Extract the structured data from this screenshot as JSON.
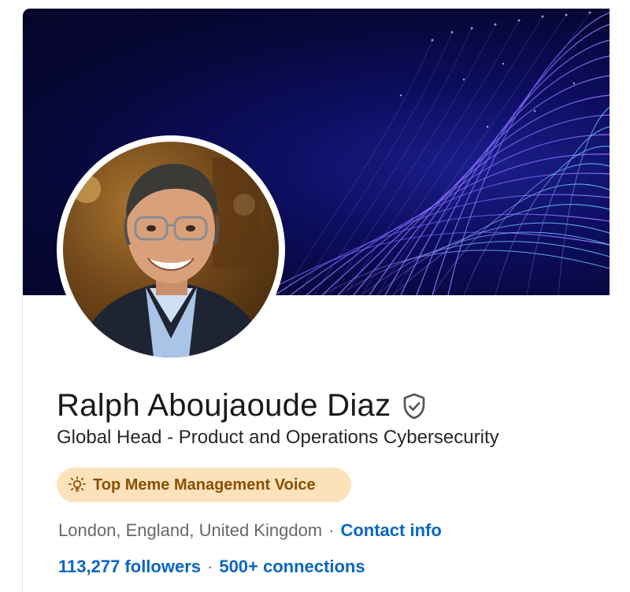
{
  "profile": {
    "name": "Ralph Aboujaoude Diaz",
    "headline": "Global Head - Product and Operations Cybersecurity",
    "badge": {
      "icon": "lightbulb-icon",
      "label": "Top Meme Management Voice",
      "background": "#fce2bb",
      "text_color": "#8a4f02"
    },
    "location": "London, England, United Kingdom",
    "separator": "·",
    "contact_info_label": "Contact info",
    "followers_label": "113,277 followers",
    "connections_label": "500+ connections",
    "verified_icon": "verified-shield-icon"
  },
  "colors": {
    "link": "#0a66c2",
    "banner_base": "#05052a"
  }
}
